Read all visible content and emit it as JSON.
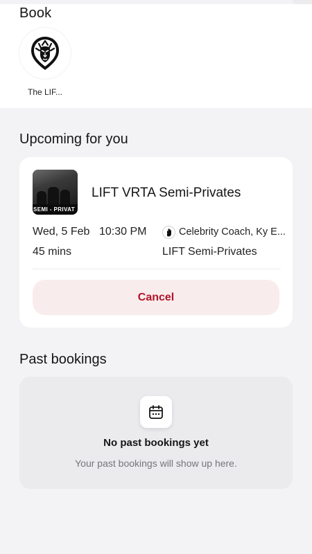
{
  "book": {
    "title": "Book",
    "venue": {
      "name": "The LIF...",
      "logo_icon": "lion-logo-icon"
    }
  },
  "upcoming": {
    "title": "Upcoming for you",
    "booking": {
      "class_name": "LIFT VRTA Semi-Privates",
      "thumbnail_caption": "SEMI - PRIVAT",
      "date": "Wed, 5 Feb",
      "time": "10:30 PM",
      "duration": "45 mins",
      "coach": "Celebrity Coach, Ky E...",
      "category": "LIFT Semi-Privates",
      "cancel_label": "Cancel"
    }
  },
  "past": {
    "title": "Past bookings",
    "empty_icon": "calendar-icon",
    "empty_title": "No past bookings yet",
    "empty_subtitle": "Your past bookings will show up here."
  },
  "colors": {
    "background": "#f3f3f5",
    "card": "#ffffff",
    "cancel_bg": "#f9ecec",
    "cancel_text": "#b2142a",
    "empty_card": "#ebebee"
  }
}
